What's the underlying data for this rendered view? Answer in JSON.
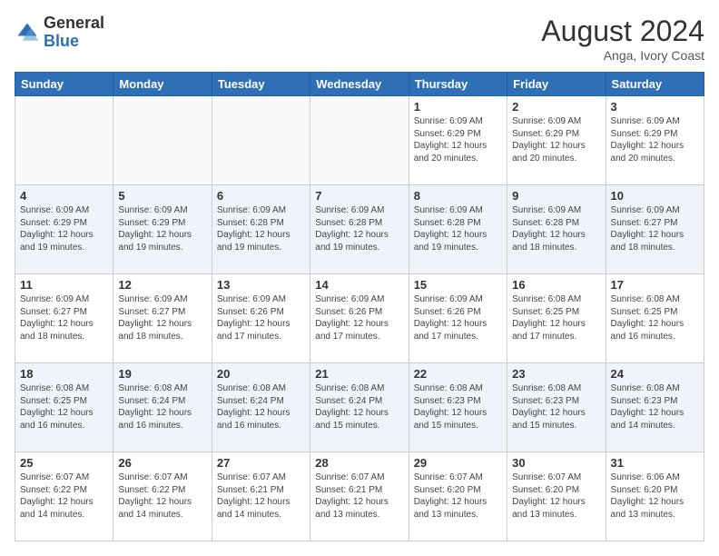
{
  "logo": {
    "general": "General",
    "blue": "Blue"
  },
  "title": "August 2024",
  "location": "Anga, Ivory Coast",
  "days_header": [
    "Sunday",
    "Monday",
    "Tuesday",
    "Wednesday",
    "Thursday",
    "Friday",
    "Saturday"
  ],
  "weeks": [
    [
      {
        "day": "",
        "info": ""
      },
      {
        "day": "",
        "info": ""
      },
      {
        "day": "",
        "info": ""
      },
      {
        "day": "",
        "info": ""
      },
      {
        "day": "1",
        "info": "Sunrise: 6:09 AM\nSunset: 6:29 PM\nDaylight: 12 hours\nand 20 minutes."
      },
      {
        "day": "2",
        "info": "Sunrise: 6:09 AM\nSunset: 6:29 PM\nDaylight: 12 hours\nand 20 minutes."
      },
      {
        "day": "3",
        "info": "Sunrise: 6:09 AM\nSunset: 6:29 PM\nDaylight: 12 hours\nand 20 minutes."
      }
    ],
    [
      {
        "day": "4",
        "info": "Sunrise: 6:09 AM\nSunset: 6:29 PM\nDaylight: 12 hours\nand 19 minutes."
      },
      {
        "day": "5",
        "info": "Sunrise: 6:09 AM\nSunset: 6:29 PM\nDaylight: 12 hours\nand 19 minutes."
      },
      {
        "day": "6",
        "info": "Sunrise: 6:09 AM\nSunset: 6:28 PM\nDaylight: 12 hours\nand 19 minutes."
      },
      {
        "day": "7",
        "info": "Sunrise: 6:09 AM\nSunset: 6:28 PM\nDaylight: 12 hours\nand 19 minutes."
      },
      {
        "day": "8",
        "info": "Sunrise: 6:09 AM\nSunset: 6:28 PM\nDaylight: 12 hours\nand 19 minutes."
      },
      {
        "day": "9",
        "info": "Sunrise: 6:09 AM\nSunset: 6:28 PM\nDaylight: 12 hours\nand 18 minutes."
      },
      {
        "day": "10",
        "info": "Sunrise: 6:09 AM\nSunset: 6:27 PM\nDaylight: 12 hours\nand 18 minutes."
      }
    ],
    [
      {
        "day": "11",
        "info": "Sunrise: 6:09 AM\nSunset: 6:27 PM\nDaylight: 12 hours\nand 18 minutes."
      },
      {
        "day": "12",
        "info": "Sunrise: 6:09 AM\nSunset: 6:27 PM\nDaylight: 12 hours\nand 18 minutes."
      },
      {
        "day": "13",
        "info": "Sunrise: 6:09 AM\nSunset: 6:26 PM\nDaylight: 12 hours\nand 17 minutes."
      },
      {
        "day": "14",
        "info": "Sunrise: 6:09 AM\nSunset: 6:26 PM\nDaylight: 12 hours\nand 17 minutes."
      },
      {
        "day": "15",
        "info": "Sunrise: 6:09 AM\nSunset: 6:26 PM\nDaylight: 12 hours\nand 17 minutes."
      },
      {
        "day": "16",
        "info": "Sunrise: 6:08 AM\nSunset: 6:25 PM\nDaylight: 12 hours\nand 17 minutes."
      },
      {
        "day": "17",
        "info": "Sunrise: 6:08 AM\nSunset: 6:25 PM\nDaylight: 12 hours\nand 16 minutes."
      }
    ],
    [
      {
        "day": "18",
        "info": "Sunrise: 6:08 AM\nSunset: 6:25 PM\nDaylight: 12 hours\nand 16 minutes."
      },
      {
        "day": "19",
        "info": "Sunrise: 6:08 AM\nSunset: 6:24 PM\nDaylight: 12 hours\nand 16 minutes."
      },
      {
        "day": "20",
        "info": "Sunrise: 6:08 AM\nSunset: 6:24 PM\nDaylight: 12 hours\nand 16 minutes."
      },
      {
        "day": "21",
        "info": "Sunrise: 6:08 AM\nSunset: 6:24 PM\nDaylight: 12 hours\nand 15 minutes."
      },
      {
        "day": "22",
        "info": "Sunrise: 6:08 AM\nSunset: 6:23 PM\nDaylight: 12 hours\nand 15 minutes."
      },
      {
        "day": "23",
        "info": "Sunrise: 6:08 AM\nSunset: 6:23 PM\nDaylight: 12 hours\nand 15 minutes."
      },
      {
        "day": "24",
        "info": "Sunrise: 6:08 AM\nSunset: 6:23 PM\nDaylight: 12 hours\nand 14 minutes."
      }
    ],
    [
      {
        "day": "25",
        "info": "Sunrise: 6:07 AM\nSunset: 6:22 PM\nDaylight: 12 hours\nand 14 minutes."
      },
      {
        "day": "26",
        "info": "Sunrise: 6:07 AM\nSunset: 6:22 PM\nDaylight: 12 hours\nand 14 minutes."
      },
      {
        "day": "27",
        "info": "Sunrise: 6:07 AM\nSunset: 6:21 PM\nDaylight: 12 hours\nand 14 minutes."
      },
      {
        "day": "28",
        "info": "Sunrise: 6:07 AM\nSunset: 6:21 PM\nDaylight: 12 hours\nand 13 minutes."
      },
      {
        "day": "29",
        "info": "Sunrise: 6:07 AM\nSunset: 6:20 PM\nDaylight: 12 hours\nand 13 minutes."
      },
      {
        "day": "30",
        "info": "Sunrise: 6:07 AM\nSunset: 6:20 PM\nDaylight: 12 hours\nand 13 minutes."
      },
      {
        "day": "31",
        "info": "Sunrise: 6:06 AM\nSunset: 6:20 PM\nDaylight: 12 hours\nand 13 minutes."
      }
    ]
  ]
}
